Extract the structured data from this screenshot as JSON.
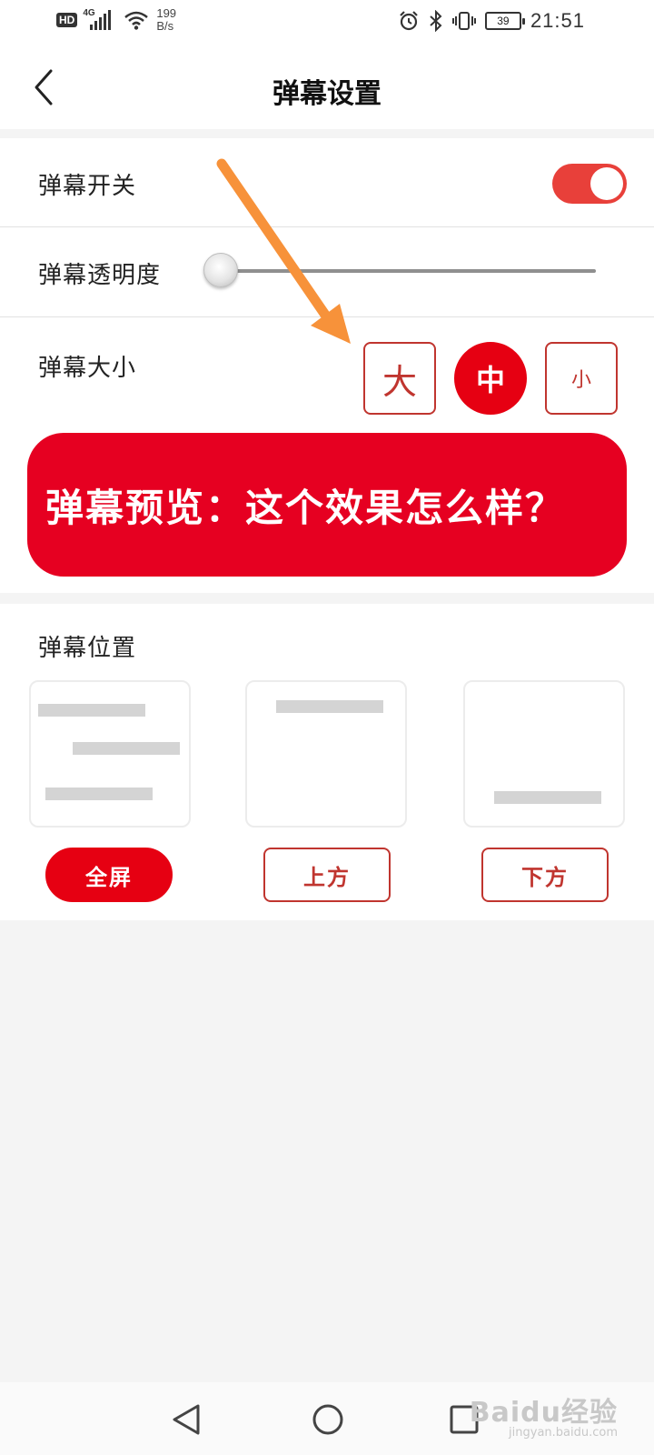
{
  "status_bar": {
    "hd_badge": "HD",
    "network_type": "4G",
    "net_speed_value": "199",
    "net_speed_unit": "B/s",
    "battery_level": "39",
    "time": "21:51",
    "icons": [
      "signal-icon",
      "wifi-icon",
      "alarm-icon",
      "bluetooth-icon",
      "vibrate-icon",
      "battery-icon"
    ]
  },
  "header": {
    "title": "弹幕设置",
    "back_icon": "chevron-left-icon"
  },
  "settings": {
    "toggle_label": "弹幕开关",
    "toggle_on": true,
    "opacity_label": "弹幕透明度",
    "opacity_value": 0,
    "size_label": "弹幕大小",
    "size_options": [
      {
        "label": "大",
        "active": false
      },
      {
        "label": "中",
        "active": true
      },
      {
        "label": "小",
        "active": false
      }
    ],
    "preview_text": "弹幕预览：这个效果怎么样？"
  },
  "position": {
    "title": "弹幕位置",
    "options": [
      {
        "label": "全屏",
        "active": true
      },
      {
        "label": "上方",
        "active": false
      },
      {
        "label": "下方",
        "active": false
      }
    ]
  },
  "colors": {
    "accent_red": "#e60012",
    "toggle_red": "#e8403a",
    "outline_red": "#c0352f",
    "annotation_arrow": "#f7923a"
  },
  "watermark": {
    "main": "Baidu经验",
    "sub": "jingyan.baidu.com"
  },
  "nav_bar": {
    "icons": [
      "back-triangle-icon",
      "home-circle-icon",
      "recents-square-icon"
    ]
  }
}
